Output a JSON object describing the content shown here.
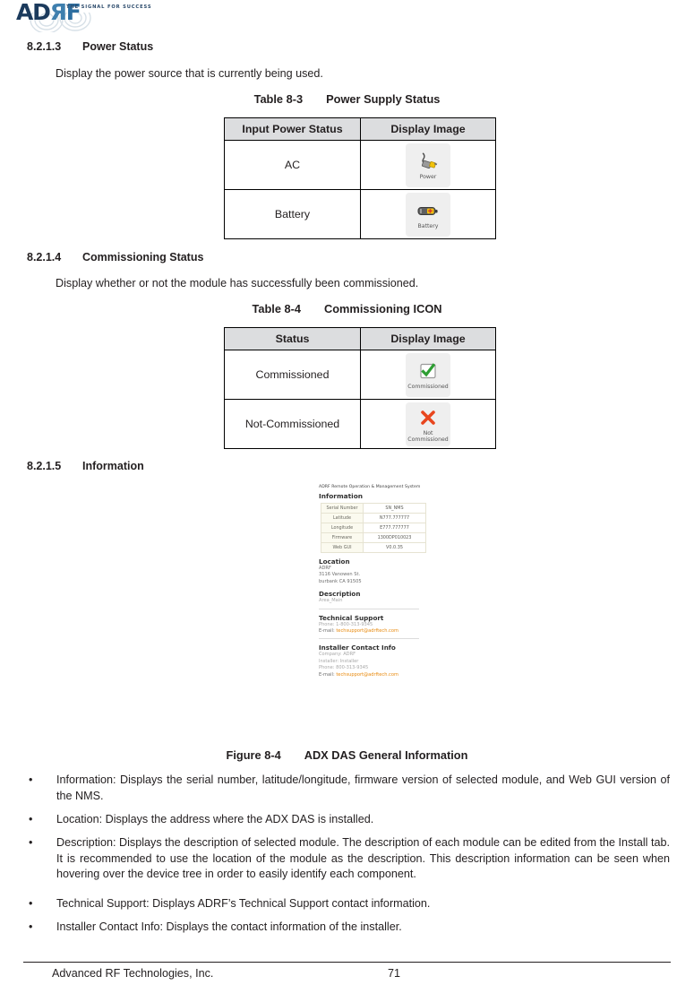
{
  "header": {
    "logo_primary": "AD",
    "logo_r": "Я",
    "logo_f": "F",
    "tagline": "THE SIGNAL FOR SUCCESS"
  },
  "sections": [
    {
      "number": "8.2.1.3",
      "title": "Power Status",
      "body": "Display the power source that is currently being used."
    },
    {
      "number": "8.2.1.4",
      "title": "Commissioning Status",
      "body": "Display whether or not the module has successfully been commissioned."
    },
    {
      "number": "8.2.1.5",
      "title": "Information",
      "body": ""
    }
  ],
  "table_power": {
    "caption_number": "Table 8-3",
    "caption_title": "Power Supply Status",
    "headers": [
      "Input Power Status",
      "Display Image"
    ],
    "rows": [
      {
        "label": "AC",
        "icon": "power-plug-icon",
        "icon_label": "Power"
      },
      {
        "label": "Battery",
        "icon": "battery-icon",
        "icon_label": "Battery"
      }
    ]
  },
  "table_commissioning": {
    "caption_number": "Table 8-4",
    "caption_title": "Commissioning ICON",
    "headers": [
      "Status",
      "Display Image"
    ],
    "rows": [
      {
        "label": "Commissioned",
        "icon": "green-check-icon",
        "icon_label": "Commissioned"
      },
      {
        "label": "Not-Commissioned",
        "icon": "red-x-icon",
        "icon_label": "Not Commissioned"
      }
    ]
  },
  "figure": {
    "caption_number": "Figure 8-4",
    "caption_title": "ADX DAS General Information",
    "screenshot": {
      "app_title": "ADRF Remote Operation & Management System",
      "information_heading": "Information",
      "info_rows": [
        {
          "key": "Serial Number",
          "value": "SN_NMS"
        },
        {
          "key": "Latitude",
          "value": "N777.777777"
        },
        {
          "key": "Longitude",
          "value": "E777.777777"
        },
        {
          "key": "Firmware",
          "value": "1300DP010023"
        },
        {
          "key": "Web GUI",
          "value": "V0.0.35"
        }
      ],
      "location_heading": "Location",
      "location_lines": [
        "ADRF",
        "3116 Vanowen St.",
        "burbank CA 91505"
      ],
      "description_heading": "Description",
      "description_value": "Area_Main",
      "tech_support_heading": "Technical Support",
      "tech_support_phone": "Phone: 1-800-313-9345",
      "tech_support_email_label": "E-mail:",
      "tech_support_email": "techsupport@adrftech.com",
      "installer_heading": "Installer Contact Info",
      "installer_company": "Company: ADRF",
      "installer_name": "Installer: Installer",
      "installer_phone": "Phone: 800-313-9345",
      "installer_email_label": "E-mail:",
      "installer_email": "techsupport@adrftech.com"
    }
  },
  "bullets": [
    "Information: Displays the serial number, latitude/longitude, firmware version of selected module, and Web GUI version of the NMS.",
    "Location: Displays the address where the ADX DAS is installed.",
    "Description: Displays the description of selected module.  The description of each module can be edited from the Install tab.  It is recommended to use the location of the module as the description.  This description information can be seen when hovering over the device tree in order to easily identify each component.",
    "Technical Support: Displays ADRF’s Technical Support contact information.",
    "Installer Contact Info: Displays the contact information of the installer."
  ],
  "bullet_marker": "•",
  "footer": {
    "company": "Advanced RF Technologies, Inc.",
    "page_number": "71"
  },
  "colors": {
    "logo_navy": "#1b3a5c",
    "logo_blue": "#3f7fae",
    "table_header_bg": "#dcdddf",
    "link_orange": "#e8890c",
    "check_green": "#2e9e33",
    "x_red": "#e8461e"
  }
}
